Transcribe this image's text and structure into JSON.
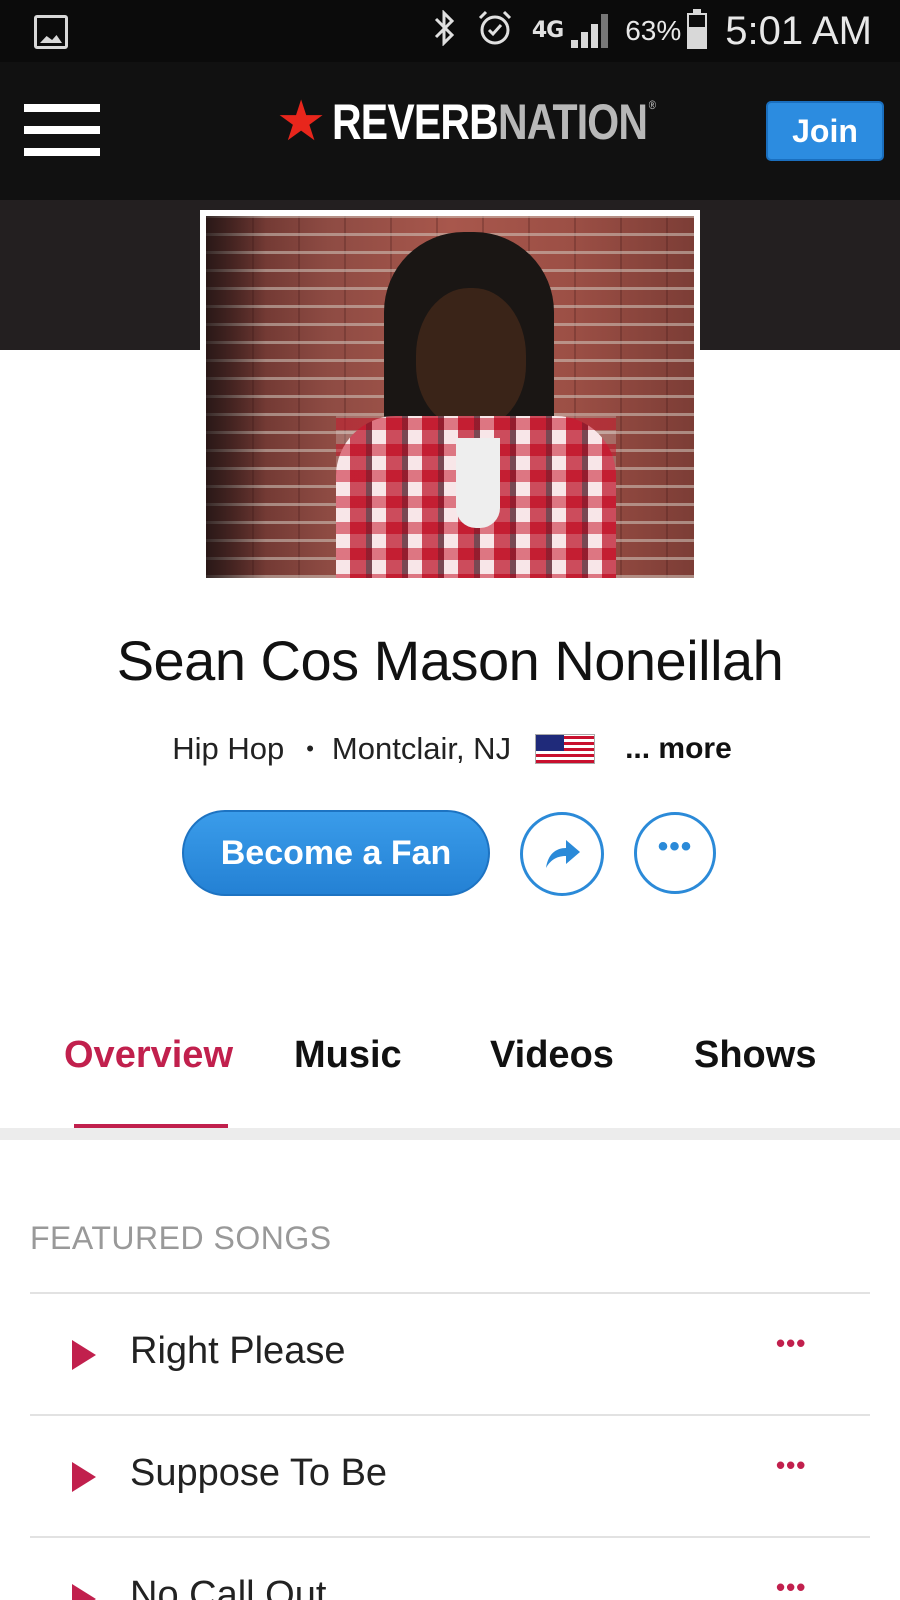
{
  "status_bar": {
    "left_icon": "gallery-icon",
    "icons": [
      "bluetooth-icon",
      "alarm-icon",
      "4g-lte-icon",
      "signal-icon",
      "battery-icon"
    ],
    "network": "4G",
    "battery": "63%",
    "battery_level": 0.63,
    "time": "5:01 AM"
  },
  "header": {
    "menu_icon": "hamburger-menu-icon",
    "logo_star": "★",
    "logo_part1": "REVERB",
    "logo_part2": "NATION",
    "logo_mark": "®",
    "join_label": "Join"
  },
  "artist": {
    "name": "Sean Cos Mason Noneillah",
    "genre": "Hip Hop",
    "separator": "•",
    "location": "Montclair, NJ",
    "country_flag": "us-flag-icon",
    "more_label": "... more"
  },
  "actions": {
    "fan_label": "Become a Fan",
    "share_icon": "share-arrow-icon",
    "options_glyph": "•••"
  },
  "tabs": [
    {
      "label": "Overview",
      "active": true
    },
    {
      "label": "Music",
      "active": false
    },
    {
      "label": "Videos",
      "active": false
    },
    {
      "label": "Shows",
      "active": false
    }
  ],
  "featured": {
    "title": "FEATURED SONGS",
    "songs": [
      {
        "title": "Right Please",
        "more": "•••"
      },
      {
        "title": "Suppose To Be",
        "more": "•••"
      },
      {
        "title": "No Call Out",
        "more": "•••"
      }
    ]
  },
  "colors": {
    "accent": "#c1204d",
    "primary_blue": "#2c8ce0",
    "header_bg": "#111111",
    "banner_bg": "#231f20"
  }
}
